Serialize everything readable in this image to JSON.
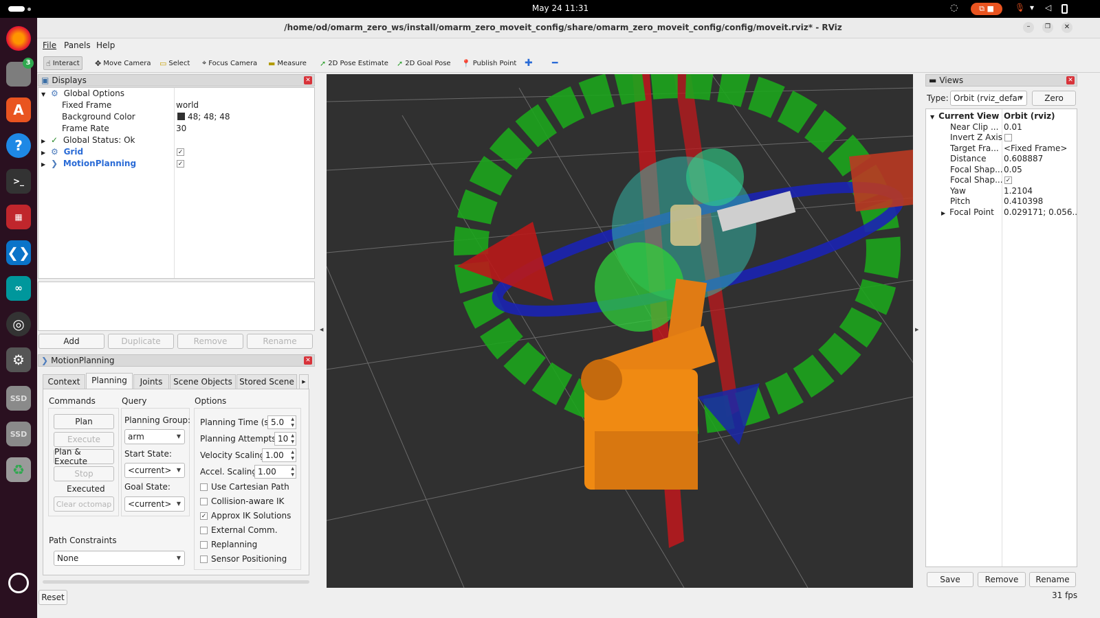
{
  "system": {
    "datetime": "May 24  11:31"
  },
  "window": {
    "title": "/home/od/omarm_zero_ws/install/omarm_zero_moveit_config/share/omarm_zero_moveit_config/config/moveit.rviz* - RViz"
  },
  "dock": {
    "files_badge": "3",
    "ssd1": "SSD",
    "ssd2": "SSD"
  },
  "menu": {
    "file": "File",
    "panels": "Panels",
    "help": "Help"
  },
  "toolbar": {
    "interact": "Interact",
    "move_camera": "Move Camera",
    "select": "Select",
    "focus_camera": "Focus Camera",
    "measure": "Measure",
    "pose_estimate": "2D Pose Estimate",
    "goal_pose": "2D Goal Pose",
    "publish_point": "Publish Point"
  },
  "displays": {
    "title": "Displays",
    "global_options": "Global Options",
    "fixed_frame": {
      "label": "Fixed Frame",
      "value": "world"
    },
    "background_color": {
      "label": "Background Color",
      "value": "48; 48; 48",
      "swatch": "#303030"
    },
    "frame_rate": {
      "label": "Frame Rate",
      "value": "30"
    },
    "global_status": "Global Status: Ok",
    "grid": "Grid",
    "motion_planning": "MotionPlanning",
    "buttons": {
      "add": "Add",
      "duplicate": "Duplicate",
      "remove": "Remove",
      "rename": "Rename"
    }
  },
  "motion_planning": {
    "title": "MotionPlanning",
    "tabs": [
      "Context",
      "Planning",
      "Joints",
      "Scene Objects",
      "Stored Scene"
    ],
    "commands": {
      "header": "Commands",
      "plan": "Plan",
      "execute": "Execute",
      "plan_execute": "Plan & Execute",
      "stop": "Stop",
      "status": "Executed",
      "clear_octomap": "Clear octomap"
    },
    "query": {
      "header": "Query",
      "planning_group_label": "Planning Group:",
      "planning_group": "arm",
      "start_state_label": "Start State:",
      "start_state": "<current>",
      "goal_state_label": "Goal State:",
      "goal_state": "<current>"
    },
    "options": {
      "header": "Options",
      "planning_time_label": "Planning Time (s):",
      "planning_time": "5.0",
      "planning_attempts_label": "Planning Attempts:",
      "planning_attempts": "10",
      "velocity_scaling_label": "Velocity Scaling:",
      "velocity_scaling": "1.00",
      "accel_scaling_label": "Accel. Scaling:",
      "accel_scaling": "1.00",
      "use_cartesian_path": "Use Cartesian Path",
      "collision_aware_ik": "Collision-aware IK",
      "approx_ik": "Approx IK Solutions",
      "external_comm": "External Comm.",
      "replanning": "Replanning",
      "sensor_positioning": "Sensor Positioning"
    },
    "path_constraints": {
      "label": "Path Constraints",
      "value": "None"
    },
    "reset": "Reset"
  },
  "views": {
    "title": "Views",
    "type_label": "Type:",
    "type_value": "Orbit (rviz_defau",
    "zero": "Zero",
    "current_view_label": "Current View",
    "current_view_value": "Orbit (rviz)",
    "props": [
      {
        "label": "Near Clip ...",
        "value": "0.01"
      },
      {
        "label": "Invert Z Axis",
        "value": ""
      },
      {
        "label": "Target Fra...",
        "value": "<Fixed Frame>"
      },
      {
        "label": "Distance",
        "value": "0.608887"
      },
      {
        "label": "Focal Shap...",
        "value": "0.05"
      },
      {
        "label": "Focal Shap...",
        "value": ""
      },
      {
        "label": "Yaw",
        "value": "1.2104"
      },
      {
        "label": "Pitch",
        "value": "0.410398"
      },
      {
        "label": "Focal Point",
        "value": "0.029171; 0.056..."
      }
    ],
    "save": "Save",
    "remove": "Remove",
    "rename": "Rename"
  },
  "statusbar": {
    "fps": "31 fps"
  }
}
